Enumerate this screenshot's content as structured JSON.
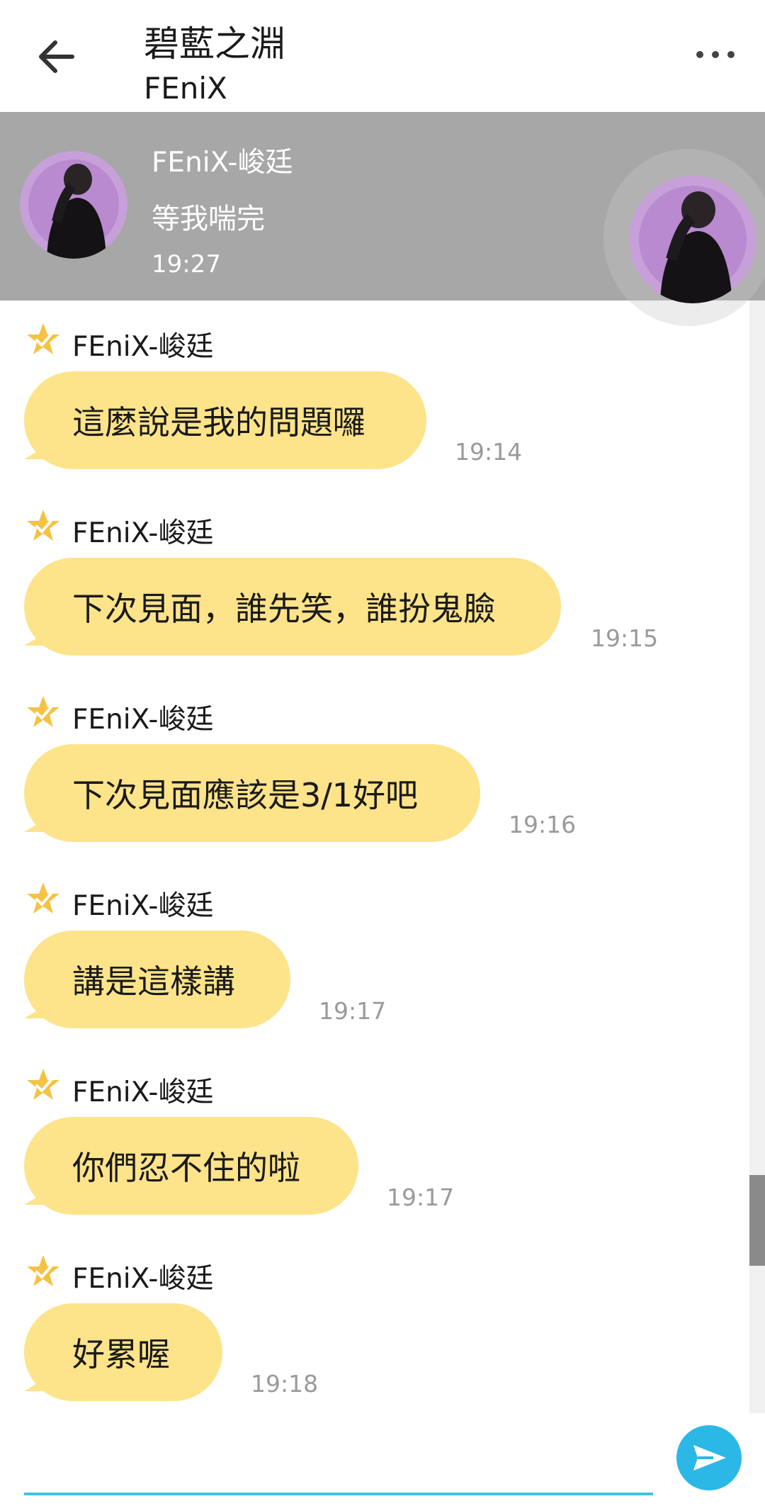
{
  "header": {
    "title": "碧藍之淵",
    "subtitle": "FEniX"
  },
  "pinned": {
    "name": "FEniX-峻廷",
    "text": "等我喘完",
    "time": "19:27"
  },
  "messages": [
    {
      "sender": "FEniX-峻廷",
      "text": "這麼說是我的問題囉",
      "time": "19:14"
    },
    {
      "sender": "FEniX-峻廷",
      "text": "下次見面，誰先笑，誰扮鬼臉",
      "time": "19:15"
    },
    {
      "sender": "FEniX-峻廷",
      "text": "下次見面應該是3/1好吧",
      "time": "19:16"
    },
    {
      "sender": "FEniX-峻廷",
      "text": "講是這樣講",
      "time": "19:17"
    },
    {
      "sender": "FEniX-峻廷",
      "text": "你們忍不住的啦",
      "time": "19:17"
    },
    {
      "sender": "FEniX-峻廷",
      "text": "好累喔",
      "time": "19:18"
    }
  ],
  "colors": {
    "bubble": "#fde38a",
    "banner": "#a7a7a7",
    "accent": "#2bb8e6"
  }
}
